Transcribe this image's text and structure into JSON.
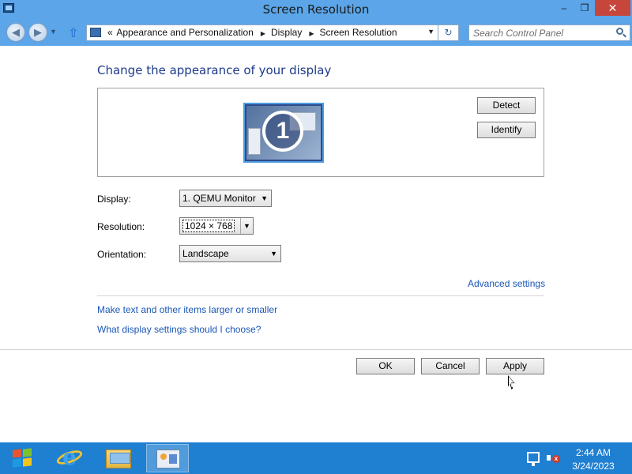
{
  "window": {
    "title": "Screen Resolution",
    "controls": {
      "minimize": "–",
      "maximize": "❐",
      "close": "✕"
    }
  },
  "address": {
    "crumbs": [
      "Appearance and Personalization",
      "Display",
      "Screen Resolution"
    ],
    "crumb_prefix": "«",
    "search_placeholder": "Search Control Panel"
  },
  "main": {
    "heading": "Change the appearance of your display",
    "monitor_number": "1",
    "detect_label": "Detect",
    "identify_label": "Identify",
    "display": {
      "label": "Display:",
      "value": "1. QEMU Monitor"
    },
    "resolution": {
      "label": "Resolution:",
      "value": "1024 × 768"
    },
    "orientation": {
      "label": "Orientation:",
      "value": "Landscape"
    },
    "advanced_link": "Advanced settings",
    "link_text_size": "Make text and other items larger or smaller",
    "link_display_help": "What display settings should I choose?",
    "ok_label": "OK",
    "cancel_label": "Cancel",
    "apply_label": "Apply"
  },
  "taskbar": {
    "items": [
      "start-icon",
      "internet-explorer-icon",
      "file-explorer-icon",
      "control-panel-icon"
    ],
    "time": "2:44 AM",
    "date": "3/24/2023"
  }
}
